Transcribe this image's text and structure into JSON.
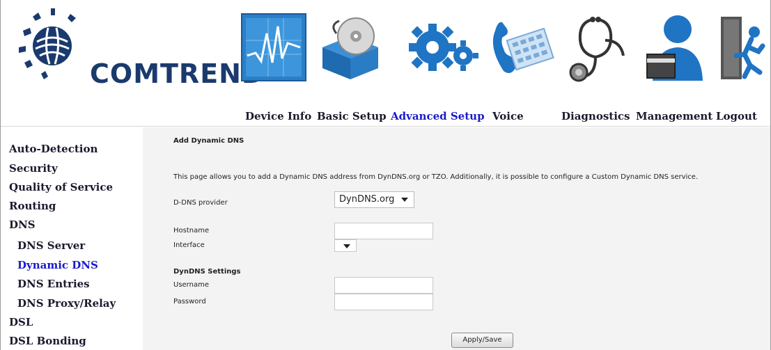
{
  "brand": {
    "name": "COMTREND"
  },
  "nav": {
    "items": [
      {
        "label": "Device Info",
        "icon": "device-info-icon"
      },
      {
        "label": "Basic Setup",
        "icon": "basic-setup-icon"
      },
      {
        "label": "Advanced Setup",
        "icon": "advanced-setup-icon",
        "active": true
      },
      {
        "label": "Voice",
        "icon": "voice-icon"
      },
      {
        "label": "Diagnostics",
        "icon": "diagnostics-icon"
      },
      {
        "label": "Management",
        "icon": "management-icon"
      },
      {
        "label": "Logout",
        "icon": "logout-icon"
      }
    ]
  },
  "sidebar": {
    "items": [
      {
        "label": "Auto-Detection"
      },
      {
        "label": "Security"
      },
      {
        "label": "Quality of Service"
      },
      {
        "label": "Routing"
      },
      {
        "label": "DNS"
      },
      {
        "label": "DNS Server",
        "sub": true
      },
      {
        "label": "Dynamic DNS",
        "sub": true,
        "active": true
      },
      {
        "label": "DNS Entries",
        "sub": true
      },
      {
        "label": "DNS Proxy/Relay",
        "sub": true
      },
      {
        "label": "DSL"
      },
      {
        "label": "DSL Bonding"
      }
    ]
  },
  "main": {
    "title": "Add Dynamic DNS",
    "description": "This page allows you to add a Dynamic DNS address from DynDNS.org or TZO. Additionally, it is possible to configure a Custom Dynamic DNS service.",
    "provider_label": "D-DNS provider",
    "provider_value": "DynDNS.org",
    "hostname_label": "Hostname",
    "hostname_value": "",
    "interface_label": "Interface",
    "interface_value": "",
    "settings_heading": "DynDNS Settings",
    "username_label": "Username",
    "username_value": "",
    "password_label": "Password",
    "password_value": "",
    "apply_label": "Apply/Save"
  },
  "colors": {
    "nav_text": "#1a1a2e",
    "active": "#1a1acc",
    "brand_blue": "#1a3a6e",
    "panel_bg": "#f3f3f3"
  }
}
